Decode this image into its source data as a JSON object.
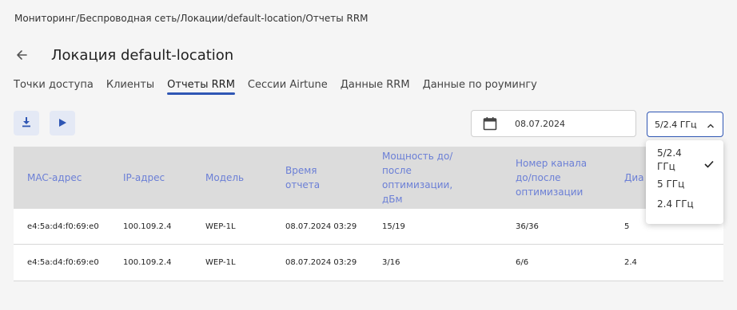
{
  "breadcrumb": "Мониторинг/Беспроводная сеть/Локации/default-location/Отчеты RRM",
  "page": {
    "title": "Локация default-location"
  },
  "tabs": [
    {
      "label": "Точки доступа",
      "active": false
    },
    {
      "label": "Клиенты",
      "active": false
    },
    {
      "label": "Отчеты RRM",
      "active": true
    },
    {
      "label": "Сессии Airtune",
      "active": false
    },
    {
      "label": "Данные RRM",
      "active": false
    },
    {
      "label": "Данные по роумингу",
      "active": false
    }
  ],
  "toolbar": {
    "download_icon": "download-icon",
    "run_icon": "play-icon"
  },
  "date_filter": {
    "icon": "calendar-icon",
    "value": "08.07.2024"
  },
  "band_select": {
    "value": "5/2.4 ГГц",
    "options": [
      "5/2.4 ГГц",
      "5 ГГц",
      "2.4 ГГц"
    ],
    "selected_index": 0
  },
  "table": {
    "columns": [
      "MAC-адрес",
      "IP-адрес",
      "Модель",
      "Время отчета",
      "Мощность до/после оптимизации, дБм",
      "Номер канала до/после оптимизации",
      "Диа"
    ],
    "rows": [
      [
        "e4:5a:d4:f0:69:e0",
        "100.109.2.4",
        "WEP-1L",
        "08.07.2024 03:29",
        "15/19",
        "36/36",
        "5"
      ],
      [
        "e4:5a:d4:f0:69:e0",
        "100.109.2.4",
        "WEP-1L",
        "08.07.2024 03:29",
        "3/16",
        "6/6",
        "2.4"
      ]
    ]
  },
  "colors": {
    "accent": "#2f56b4",
    "header_text": "#6b7fd6",
    "header_bg": "#dcdcdc",
    "button_bg": "#e4e9f5"
  }
}
